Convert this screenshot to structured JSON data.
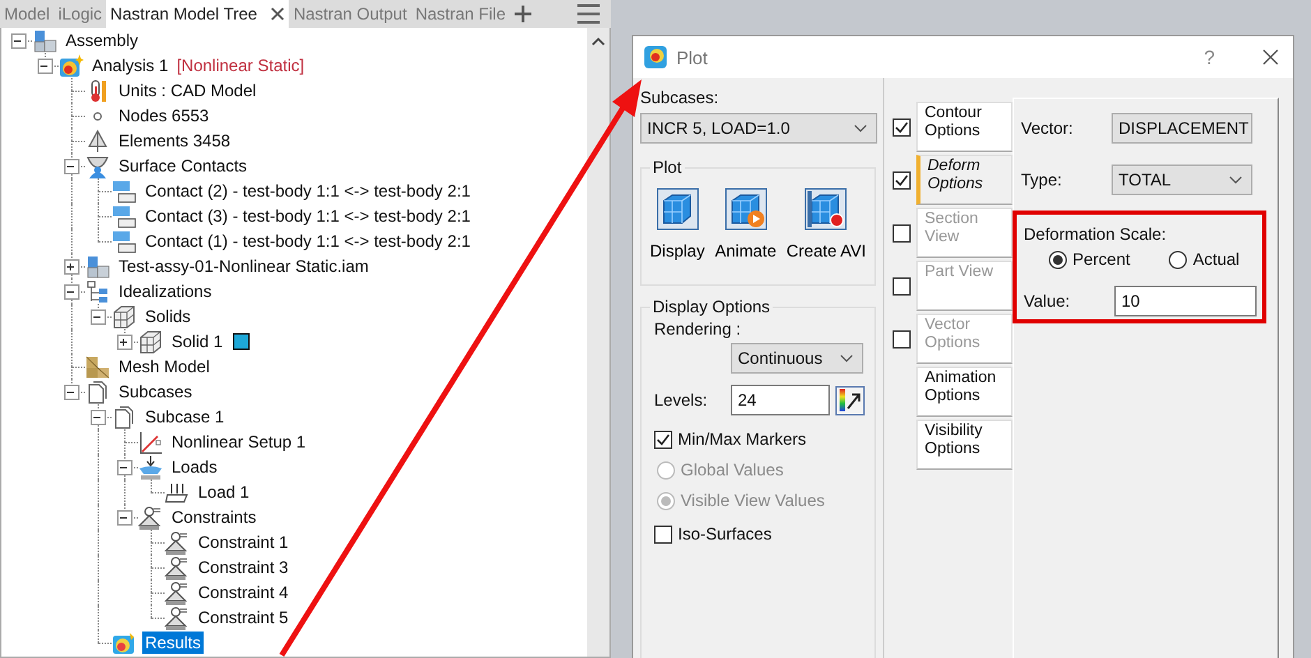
{
  "tabs": [
    {
      "label": "Model",
      "selected": false
    },
    {
      "label": "iLogic",
      "selected": false
    },
    {
      "label": "Nastran Model Tree",
      "selected": true
    },
    {
      "label": "Nastran Output",
      "selected": false
    },
    {
      "label": "Nastran File",
      "selected": false
    }
  ],
  "tree": [
    {
      "label": "Assembly",
      "kind": "assembly",
      "expanded": true,
      "selected": false,
      "children": [
        {
          "label": "Analysis 1",
          "tag": "[Nonlinear Static]",
          "kind": "analysis",
          "expanded": true,
          "selected": false,
          "children": [
            {
              "label": "Units : CAD Model",
              "kind": "units",
              "selected": false
            },
            {
              "label": "Nodes 6553",
              "kind": "nodes",
              "selected": false
            },
            {
              "label": "Elements 3458",
              "kind": "elements",
              "selected": false
            },
            {
              "label": "Surface Contacts",
              "kind": "contacts",
              "expanded": true,
              "selected": false,
              "children": [
                {
                  "label": "Contact (2) - test-body 1:1 <-> test-body 2:1",
                  "kind": "contact",
                  "selected": false
                },
                {
                  "label": "Contact (3) - test-body 1:1 <-> test-body 2:1",
                  "kind": "contact",
                  "selected": false
                },
                {
                  "label": "Contact (1) - test-body 1:1 <-> test-body 2:1",
                  "kind": "contact",
                  "selected": false
                }
              ]
            },
            {
              "label": "Test-assy-01-Nonlinear Static.iam",
              "kind": "assembly",
              "expanded": false,
              "selected": false
            },
            {
              "label": "Idealizations",
              "kind": "idealizations",
              "expanded": true,
              "selected": false,
              "children": [
                {
                  "label": "Solids",
                  "kind": "solid",
                  "expanded": true,
                  "selected": false,
                  "children": [
                    {
                      "label": "Solid 1",
                      "kind": "solid",
                      "expanded": false,
                      "selected": false,
                      "color": "#1ea8d8"
                    }
                  ]
                }
              ]
            },
            {
              "label": "Mesh Model",
              "kind": "mesh",
              "selected": false
            },
            {
              "label": "Subcases",
              "kind": "subcase",
              "expanded": true,
              "selected": false,
              "children": [
                {
                  "label": "Subcase 1",
                  "kind": "subcase",
                  "expanded": true,
                  "selected": false,
                  "children": [
                    {
                      "label": "Nonlinear Setup 1",
                      "kind": "setup",
                      "selected": false
                    },
                    {
                      "label": "Loads",
                      "kind": "loads",
                      "expanded": true,
                      "selected": false,
                      "children": [
                        {
                          "label": "Load 1",
                          "kind": "load",
                          "selected": false
                        }
                      ]
                    },
                    {
                      "label": "Constraints",
                      "kind": "constraint",
                      "expanded": true,
                      "selected": false,
                      "children": [
                        {
                          "label": "Constraint 1",
                          "kind": "constraint",
                          "selected": false
                        },
                        {
                          "label": "Constraint 3",
                          "kind": "constraint",
                          "selected": false
                        },
                        {
                          "label": "Constraint 4",
                          "kind": "constraint",
                          "selected": false
                        },
                        {
                          "label": "Constraint 5",
                          "kind": "constraint",
                          "selected": false
                        }
                      ]
                    }
                  ]
                },
                {
                  "label": "Results",
                  "kind": "results",
                  "selected": true
                }
              ]
            }
          ]
        }
      ]
    }
  ],
  "dialog": {
    "title": "Plot",
    "help": "?",
    "subcases": {
      "label": "Subcases:",
      "value": "INCR 5, LOAD=1.0"
    },
    "plot_group": {
      "title": "Plot",
      "buttons": [
        {
          "label": "Display",
          "kind": "display"
        },
        {
          "label": "Animate",
          "kind": "animate"
        },
        {
          "label": "Create AVI",
          "kind": "avi"
        }
      ]
    },
    "display_options": {
      "title": "Display Options",
      "rendering": {
        "label": "Rendering :",
        "value": "Continuous"
      },
      "levels": {
        "label": "Levels:",
        "value": "24"
      },
      "min_max": {
        "label": "Min/Max Markers",
        "checked": true
      },
      "markers": [
        {
          "label": "Global Values",
          "selected": false,
          "disabled": true
        },
        {
          "label": "Visible View Values",
          "selected": true,
          "disabled": true
        }
      ],
      "iso_surfaces": {
        "label": "Iso-Surfaces",
        "checked": false
      }
    },
    "option_tabs": [
      {
        "kind": "check",
        "label": "Contour Options",
        "checked": true,
        "disabled": false,
        "selected": false
      },
      {
        "kind": "check",
        "label": "Deform Options",
        "checked": true,
        "disabled": false,
        "selected": true
      },
      {
        "kind": "check",
        "label": "Section View",
        "checked": false,
        "disabled": true,
        "selected": false
      },
      {
        "kind": "check",
        "label": "Part View",
        "checked": false,
        "disabled": true,
        "selected": false
      },
      {
        "kind": "check",
        "label": "Vector Options",
        "checked": false,
        "disabled": true,
        "selected": false
      },
      {
        "kind": "plain",
        "label": "Animation Options",
        "disabled": false,
        "selected": false
      },
      {
        "kind": "plain",
        "label": "Visibility Options",
        "disabled": false,
        "selected": false
      }
    ],
    "panel": {
      "vector": {
        "label": "Vector:",
        "value": "DISPLACEMENT"
      },
      "type": {
        "label": "Type:",
        "value": "TOTAL"
      },
      "deformation": {
        "title": "Deformation Scale:",
        "modes": [
          {
            "label": "Percent",
            "selected": true
          },
          {
            "label": "Actual",
            "selected": false
          }
        ],
        "value": {
          "label": "Value:",
          "value": "10"
        }
      }
    }
  }
}
